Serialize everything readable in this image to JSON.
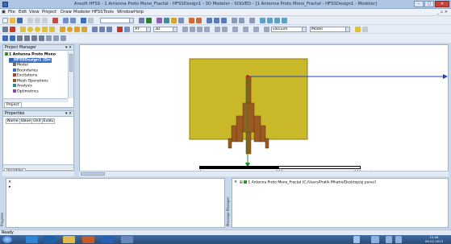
{
  "window": {
    "title": "Ansoft HFSS - 1 Antenna Proto Mono_Fractal - HFSSDesign1 - 3D Modeler - SOLVED - [1 Antenna Proto Mono_Fractal - HFSSDesign1 - Modeler]",
    "minimize": "–",
    "maximize": "□",
    "close": "✕"
  },
  "menu": {
    "items": [
      "File",
      "Edit",
      "View",
      "Project",
      "Draw",
      "Modeler",
      "HFSS",
      "Tools",
      "Window",
      "Help"
    ],
    "right": "_ ▫ ×"
  },
  "toolbar": {
    "plane": "XY",
    "dim": "3D",
    "material": "vacuum",
    "model": "Model"
  },
  "project_manager": {
    "title": "Project Manager",
    "close": "▾ ×",
    "tree": [
      {
        "label": "1 Antenna Proto Mono",
        "bold": true,
        "indent": 1,
        "color": "#2f8f3a"
      },
      {
        "label": "HFSSDesign1 (Dri",
        "bold": true,
        "indent": 2,
        "color": "#2f64b8",
        "selected": true
      },
      {
        "label": "Model",
        "indent": 3,
        "color": "#6f6f6f"
      },
      {
        "label": "Boundaries",
        "indent": 3,
        "color": "#3b6fc5"
      },
      {
        "label": "Excitations",
        "indent": 3,
        "color": "#c0392b"
      },
      {
        "label": "Mesh Operations",
        "indent": 3,
        "color": "#8d5a2b"
      },
      {
        "label": "Analysis",
        "indent": 3,
        "color": "#2b8f8f"
      },
      {
        "label": "Optimetrics",
        "indent": 3,
        "color": "#7a4fb5"
      }
    ],
    "tab": "Project"
  },
  "properties": {
    "title": "Properties",
    "close": "▾ ×",
    "columns": [
      "Name",
      "Value",
      "Unit",
      "Evalu"
    ],
    "tab": "Variables"
  },
  "model_tree": {
    "items": [
      "Solids",
      "Sheets",
      "Coordinate",
      "Planes",
      "Lists"
    ],
    "icon_colors": [
      "#7e8796",
      "#7e8796",
      "#3f6bb8",
      "#5c6fa0",
      "#6a8a3a"
    ]
  },
  "scale": {
    "labels": [
      "0",
      "100",
      "200 (mm)"
    ]
  },
  "message_manager": {
    "side_label": "Message Manager",
    "item": "1 Antenna Proto Mono_Fractal (C:/Users/Pratik Mhatre/Desktop/aj pune/)"
  },
  "progress": {
    "side_label": "Progress"
  },
  "status_bar": {
    "text": "Ready"
  },
  "taskbar": {
    "time": "12:06",
    "date": "06-02-2013"
  },
  "colors": {
    "substrate": "#c9b827",
    "substrate_edge": "#8e7f17",
    "antenna": "#9b5a1f",
    "antenna_edge": "#5e3510",
    "axis_x": "#1f3fbf",
    "axis_y": "#1c8c2a",
    "axis_dot": "#c0291b"
  }
}
